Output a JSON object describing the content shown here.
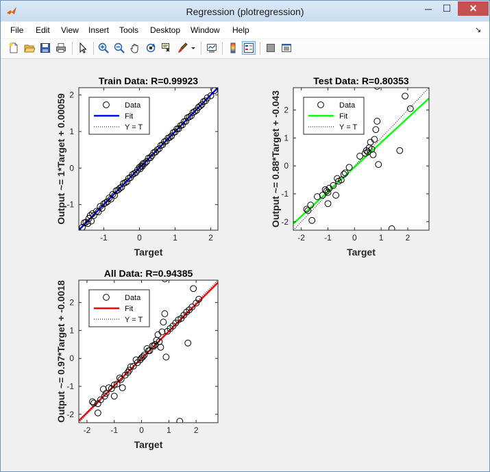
{
  "window": {
    "title": "Regression (plotregression)",
    "minimize_glyph": "─",
    "maximize_glyph": "☐",
    "close_glyph": "✕"
  },
  "menu": {
    "items": [
      "File",
      "Edit",
      "View",
      "Insert",
      "Tools",
      "Desktop",
      "Window",
      "Help"
    ],
    "dock_arrow": "↘"
  },
  "toolbar": {
    "icons": [
      "new-figure-icon",
      "open-file-icon",
      "save-icon",
      "print-icon",
      "edit-plot-arrow-icon",
      "zoom-in-icon",
      "zoom-out-icon",
      "pan-hand-icon",
      "rotate-3d-icon",
      "data-cursor-icon",
      "brush-icon",
      "link-plot-icon",
      "insert-colorbar-icon",
      "insert-legend-icon",
      "hide-plot-tools-icon",
      "show-plot-tools-icon"
    ]
  },
  "colors": {
    "train_fit": "#0000ff",
    "test_fit": "#00ff00",
    "all_fit": "#ff0000",
    "data_marker": "#000000"
  },
  "chart_data": [
    {
      "type": "scatter",
      "title": "Train Data: R=0.99923",
      "xlabel": "Target",
      "ylabel": "Output ~= 1*Target + 0.00059",
      "xlim": [
        -1.7,
        2.2
      ],
      "ylim": [
        -1.7,
        2.2
      ],
      "xticks": [
        "-1",
        "0",
        "1",
        "2"
      ],
      "yticks": [
        "-1",
        "0",
        "1",
        "2"
      ],
      "fit": {
        "slope": 1.0,
        "intercept": 0.00059
      },
      "legend": {
        "placement": "top-left",
        "entries": [
          "Data",
          "Fit",
          "Y = T"
        ]
      },
      "points": [
        [
          -1.6,
          -1.62
        ],
        [
          -1.55,
          -1.5
        ],
        [
          -1.5,
          -1.48
        ],
        [
          -1.45,
          -1.52
        ],
        [
          -1.42,
          -1.38
        ],
        [
          -1.38,
          -1.3
        ],
        [
          -1.35,
          -1.45
        ],
        [
          -1.32,
          -1.25
        ],
        [
          -1.28,
          -1.3
        ],
        [
          -1.2,
          -1.18
        ],
        [
          -1.15,
          -1.2
        ],
        [
          -1.1,
          -1.05
        ],
        [
          -1.05,
          -1.1
        ],
        [
          -1.0,
          -0.98
        ],
        [
          -0.95,
          -0.95
        ],
        [
          -0.9,
          -0.92
        ],
        [
          -0.85,
          -0.82
        ],
        [
          -0.8,
          -0.85
        ],
        [
          -0.75,
          -0.72
        ],
        [
          -0.7,
          -0.75
        ],
        [
          -0.65,
          -0.62
        ],
        [
          -0.6,
          -0.6
        ],
        [
          -0.55,
          -0.55
        ],
        [
          -0.5,
          -0.52
        ],
        [
          -0.45,
          -0.42
        ],
        [
          -0.4,
          -0.4
        ],
        [
          -0.35,
          -0.37
        ],
        [
          -0.3,
          -0.28
        ],
        [
          -0.25,
          -0.26
        ],
        [
          -0.2,
          -0.18
        ],
        [
          -0.15,
          -0.15
        ],
        [
          -0.1,
          -0.12
        ],
        [
          -0.05,
          -0.05
        ],
        [
          0.0,
          0.02
        ],
        [
          0.02,
          -0.02
        ],
        [
          0.05,
          0.06
        ],
        [
          0.08,
          0.05
        ],
        [
          0.1,
          0.12
        ],
        [
          0.15,
          0.13
        ],
        [
          0.2,
          0.18
        ],
        [
          0.25,
          0.27
        ],
        [
          0.3,
          0.28
        ],
        [
          0.35,
          0.34
        ],
        [
          0.4,
          0.42
        ],
        [
          0.45,
          0.44
        ],
        [
          0.5,
          0.5
        ],
        [
          0.55,
          0.53
        ],
        [
          0.6,
          0.62
        ],
        [
          0.65,
          0.64
        ],
        [
          0.7,
          0.72
        ],
        [
          0.75,
          0.74
        ],
        [
          0.8,
          0.82
        ],
        [
          0.85,
          0.84
        ],
        [
          0.9,
          0.88
        ],
        [
          0.95,
          0.97
        ],
        [
          1.0,
          0.99
        ],
        [
          1.05,
          1.07
        ],
        [
          1.1,
          1.08
        ],
        [
          1.15,
          1.16
        ],
        [
          1.2,
          1.18
        ],
        [
          1.25,
          1.27
        ],
        [
          1.3,
          1.28
        ],
        [
          1.35,
          1.38
        ],
        [
          1.4,
          1.4
        ],
        [
          1.45,
          1.43
        ],
        [
          1.5,
          1.52
        ],
        [
          1.55,
          1.55
        ],
        [
          1.6,
          1.58
        ],
        [
          1.65,
          1.66
        ],
        [
          1.7,
          1.7
        ],
        [
          1.75,
          1.74
        ],
        [
          1.8,
          1.82
        ],
        [
          1.85,
          1.84
        ],
        [
          1.9,
          1.92
        ],
        [
          2.0,
          1.98
        ],
        [
          2.1,
          2.12
        ]
      ]
    },
    {
      "type": "scatter",
      "title": "Test Data: R=0.80353",
      "xlabel": "Target",
      "ylabel": "Output ~= 0.88*Target + -0.043",
      "xlim": [
        -2.3,
        2.8
      ],
      "ylim": [
        -2.3,
        2.8
      ],
      "xticks": [
        "-2",
        "-1",
        "0",
        "1",
        "2"
      ],
      "yticks": [
        "-2",
        "-1",
        "0",
        "1",
        "2"
      ],
      "fit": {
        "slope": 0.88,
        "intercept": -0.043
      },
      "legend": {
        "placement": "top-left",
        "entries": [
          "Data",
          "Fit",
          "Y = T"
        ]
      },
      "points": [
        [
          -1.8,
          -1.55
        ],
        [
          -1.75,
          -1.6
        ],
        [
          -1.65,
          -1.4
        ],
        [
          -1.6,
          -1.95
        ],
        [
          -1.4,
          -1.1
        ],
        [
          -1.2,
          -1.05
        ],
        [
          -1.1,
          -0.85
        ],
        [
          -1.05,
          -0.9
        ],
        [
          -1.0,
          -0.95
        ],
        [
          -0.95,
          -0.8
        ],
        [
          -1.0,
          -1.35
        ],
        [
          -0.8,
          -0.7
        ],
        [
          -0.7,
          -1.05
        ],
        [
          -0.65,
          -0.45
        ],
        [
          -0.6,
          -0.55
        ],
        [
          -0.5,
          -0.5
        ],
        [
          -0.4,
          -0.3
        ],
        [
          -0.35,
          -0.25
        ],
        [
          -0.2,
          -0.05
        ],
        [
          0.2,
          0.35
        ],
        [
          0.4,
          0.45
        ],
        [
          0.45,
          0.55
        ],
        [
          0.5,
          0.5
        ],
        [
          0.55,
          0.65
        ],
        [
          0.6,
          0.85
        ],
        [
          0.65,
          0.6
        ],
        [
          0.7,
          0.4
        ],
        [
          0.75,
          0.95
        ],
        [
          0.8,
          1.3
        ],
        [
          0.85,
          1.6
        ],
        [
          0.9,
          0.05
        ],
        [
          0.85,
          2.85
        ],
        [
          1.4,
          -2.25
        ],
        [
          1.7,
          0.55
        ],
        [
          1.9,
          2.5
        ],
        [
          2.1,
          2.05
        ]
      ]
    },
    {
      "type": "scatter",
      "title": "All Data: R=0.94385",
      "xlabel": "Target",
      "ylabel": "Output ~= 0.97*Target + -0.0018",
      "xlim": [
        -2.3,
        2.8
      ],
      "ylim": [
        -2.3,
        2.8
      ],
      "xticks": [
        "-2",
        "-1",
        "0",
        "1",
        "2"
      ],
      "yticks": [
        "-2",
        "-1",
        "0",
        "1",
        "2"
      ],
      "fit": {
        "slope": 0.97,
        "intercept": -0.0018
      },
      "legend": {
        "placement": "top-left",
        "entries": [
          "Data",
          "Fit",
          "Y = T"
        ]
      },
      "points": [
        [
          -1.8,
          -1.55
        ],
        [
          -1.75,
          -1.6
        ],
        [
          -1.6,
          -1.95
        ],
        [
          -1.6,
          -1.62
        ],
        [
          -1.5,
          -1.48
        ],
        [
          -1.4,
          -1.1
        ],
        [
          -1.35,
          -1.35
        ],
        [
          -1.3,
          -1.25
        ],
        [
          -1.2,
          -1.05
        ],
        [
          -1.1,
          -1.08
        ],
        [
          -1.0,
          -1.35
        ],
        [
          -1.0,
          -0.95
        ],
        [
          -0.9,
          -0.92
        ],
        [
          -0.8,
          -0.7
        ],
        [
          -0.75,
          -0.75
        ],
        [
          -0.7,
          -1.05
        ],
        [
          -0.6,
          -0.6
        ],
        [
          -0.5,
          -0.5
        ],
        [
          -0.45,
          -0.42
        ],
        [
          -0.4,
          -0.3
        ],
        [
          -0.3,
          -0.28
        ],
        [
          -0.2,
          -0.05
        ],
        [
          -0.15,
          -0.15
        ],
        [
          -0.05,
          -0.05
        ],
        [
          0.0,
          0.02
        ],
        [
          0.05,
          0.06
        ],
        [
          0.1,
          0.12
        ],
        [
          0.2,
          0.35
        ],
        [
          0.25,
          0.27
        ],
        [
          0.3,
          0.28
        ],
        [
          0.4,
          0.45
        ],
        [
          0.45,
          0.44
        ],
        [
          0.5,
          0.5
        ],
        [
          0.55,
          0.65
        ],
        [
          0.6,
          0.85
        ],
        [
          0.65,
          0.6
        ],
        [
          0.7,
          0.4
        ],
        [
          0.75,
          0.95
        ],
        [
          0.8,
          1.3
        ],
        [
          0.85,
          1.6
        ],
        [
          0.9,
          0.05
        ],
        [
          0.85,
          2.85
        ],
        [
          0.95,
          0.97
        ],
        [
          1.05,
          1.07
        ],
        [
          1.15,
          1.16
        ],
        [
          1.25,
          1.27
        ],
        [
          1.35,
          1.38
        ],
        [
          1.4,
          -2.25
        ],
        [
          1.45,
          1.43
        ],
        [
          1.55,
          1.55
        ],
        [
          1.65,
          1.66
        ],
        [
          1.7,
          0.55
        ],
        [
          1.75,
          1.74
        ],
        [
          1.85,
          1.84
        ],
        [
          1.9,
          2.5
        ],
        [
          2.0,
          1.98
        ],
        [
          2.1,
          2.12
        ]
      ]
    }
  ]
}
